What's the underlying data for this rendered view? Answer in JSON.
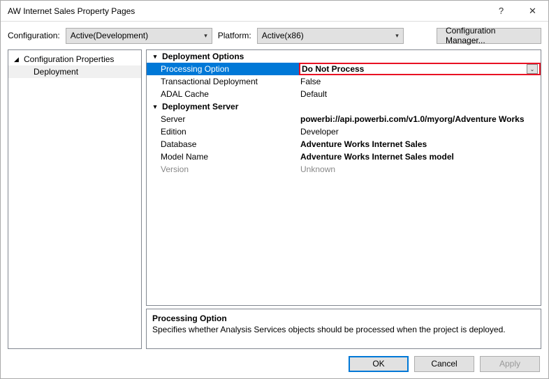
{
  "window": {
    "title": "AW Internet Sales Property Pages",
    "help": "?",
    "close": "✕"
  },
  "configRow": {
    "configLabel": "Configuration:",
    "configValue": "Active(Development)",
    "platformLabel": "Platform:",
    "platformValue": "Active(x86)",
    "managerBtn": "Configuration Manager..."
  },
  "tree": {
    "root": "Configuration Properties",
    "child": "Deployment"
  },
  "grid": {
    "sections": {
      "deployOptions": "Deployment Options",
      "deployServer": "Deployment Server"
    },
    "rows": {
      "processingOption": {
        "label": "Processing Option",
        "value": "Do Not Process"
      },
      "transactional": {
        "label": "Transactional Deployment",
        "value": "False"
      },
      "adal": {
        "label": "ADAL Cache",
        "value": "Default"
      },
      "server": {
        "label": "Server",
        "value": "powerbi://api.powerbi.com/v1.0/myorg/Adventure Works"
      },
      "edition": {
        "label": "Edition",
        "value": "Developer"
      },
      "database": {
        "label": "Database",
        "value": "Adventure Works Internet Sales"
      },
      "modelName": {
        "label": "Model Name",
        "value": "Adventure Works Internet Sales model"
      },
      "version": {
        "label": "Version",
        "value": "Unknown"
      }
    }
  },
  "description": {
    "title": "Processing Option",
    "text": "Specifies whether Analysis Services objects should be processed when the project is deployed."
  },
  "footer": {
    "ok": "OK",
    "cancel": "Cancel",
    "apply": "Apply"
  }
}
